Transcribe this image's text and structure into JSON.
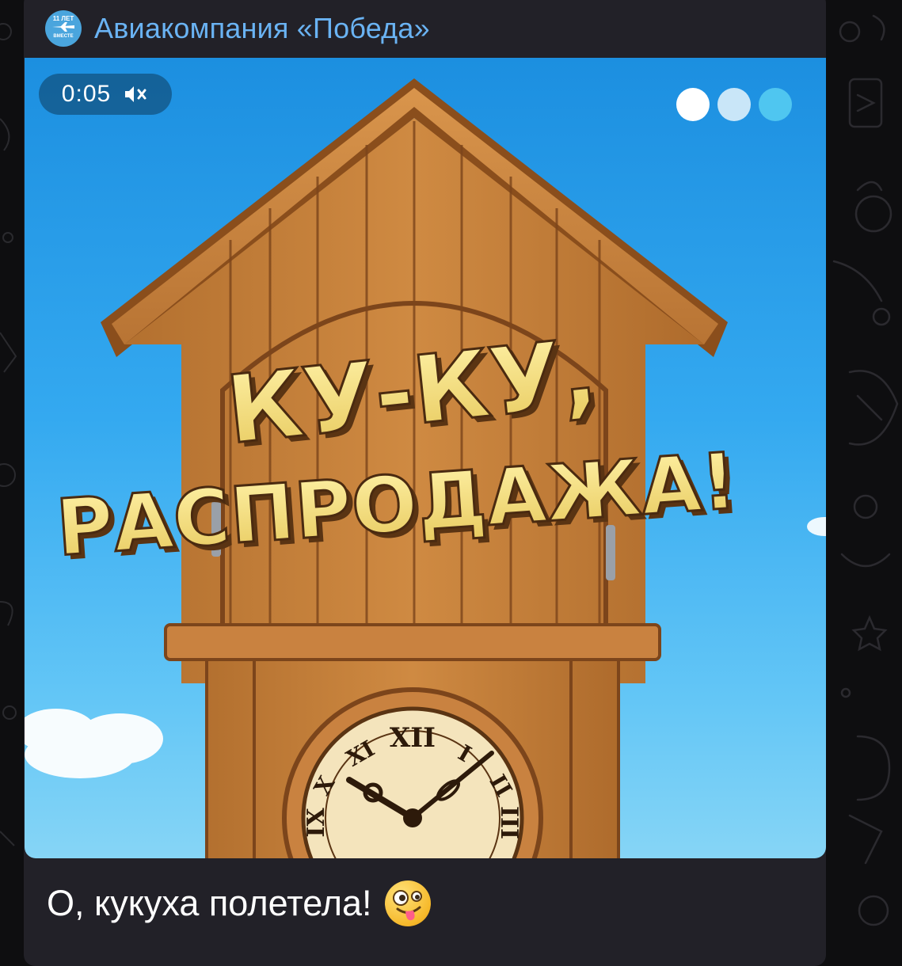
{
  "channel": {
    "name": "Авиакомпания «Победа»",
    "avatar_text_top": "11 ЛЕТ",
    "avatar_text_bottom": "ВМЕСТЕ",
    "name_color": "#6ab3f3"
  },
  "media": {
    "type": "video",
    "time": "0:05",
    "mute_icon": "speaker-muted-icon",
    "pager_dots": [
      {
        "state": "active",
        "color": "#ffffff"
      },
      {
        "state": "inactive",
        "color": "#c9e6f8"
      },
      {
        "state": "inactive",
        "color": "#4fc6f0"
      }
    ],
    "headline_line1": "КУ-КУ,",
    "headline_line2": "РАСПРОДАЖА!",
    "clock_numerals": [
      "XII",
      "I",
      "II",
      "III",
      "IX",
      "X",
      "XI"
    ]
  },
  "message": {
    "caption": "О, кукуха полетела!",
    "emoji": "zany-face-emoji"
  },
  "colors": {
    "background": "#0e0e10",
    "bubble": "#222128",
    "sky": "#2ea3ec"
  }
}
